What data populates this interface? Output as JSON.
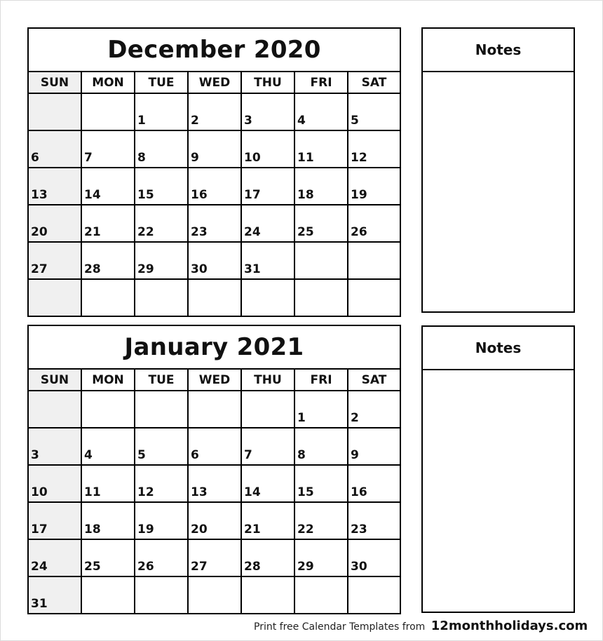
{
  "weekdays": [
    "SUN",
    "MON",
    "TUE",
    "WED",
    "THU",
    "FRI",
    "SAT"
  ],
  "calendars": [
    {
      "title": "December 2020",
      "weeks": [
        [
          "",
          "",
          "1",
          "2",
          "3",
          "4",
          "5"
        ],
        [
          "6",
          "7",
          "8",
          "9",
          "10",
          "11",
          "12"
        ],
        [
          "13",
          "14",
          "15",
          "16",
          "17",
          "18",
          "19"
        ],
        [
          "20",
          "21",
          "22",
          "23",
          "24",
          "25",
          "26"
        ],
        [
          "27",
          "28",
          "29",
          "30",
          "31",
          "",
          ""
        ],
        [
          "",
          "",
          "",
          "",
          "",
          "",
          ""
        ]
      ]
    },
    {
      "title": "January 2021",
      "weeks": [
        [
          "",
          "",
          "",
          "",
          "",
          "1",
          "2"
        ],
        [
          "3",
          "4",
          "5",
          "6",
          "7",
          "8",
          "9"
        ],
        [
          "10",
          "11",
          "12",
          "13",
          "14",
          "15",
          "16"
        ],
        [
          "17",
          "18",
          "19",
          "20",
          "21",
          "22",
          "23"
        ],
        [
          "24",
          "25",
          "26",
          "27",
          "28",
          "29",
          "30"
        ],
        [
          "31",
          "",
          "",
          "",
          "",
          "",
          ""
        ]
      ]
    }
  ],
  "notes": [
    {
      "title": "Notes"
    },
    {
      "title": "Notes"
    }
  ],
  "footer": {
    "text": "Print free Calendar Templates from",
    "site": "12monthholidays.com"
  }
}
